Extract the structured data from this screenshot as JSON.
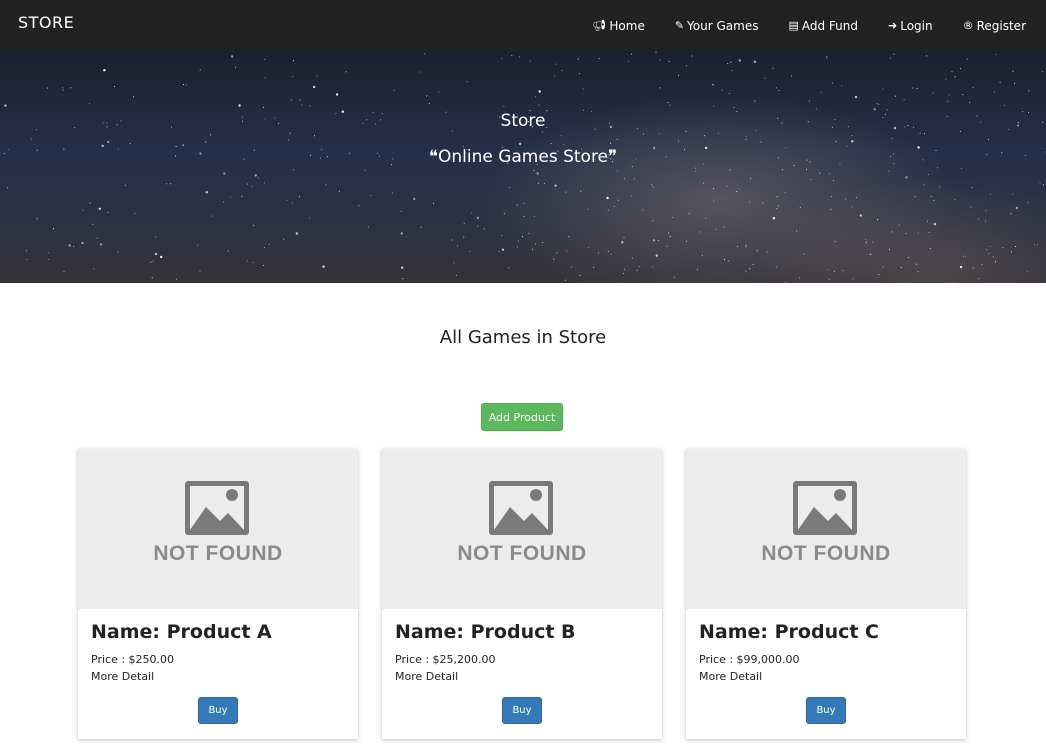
{
  "navbar": {
    "brand": "STORE",
    "links": [
      {
        "label": "Home",
        "icon": "bullhorn-icon"
      },
      {
        "label": "Your Games",
        "icon": "edit-icon"
      },
      {
        "label": "Add Fund",
        "icon": "book-icon"
      },
      {
        "label": "Login",
        "icon": "sign-in-icon"
      },
      {
        "label": "Register",
        "icon": "registered-icon"
      }
    ]
  },
  "hero": {
    "title": "Store",
    "subtitle": "❝Online Games Store❞"
  },
  "main": {
    "section_title": "All Games in Store",
    "add_button": "Add Product",
    "placeholder_text": "NOT FOUND",
    "products": [
      {
        "name": "Name: Product A",
        "price": "Price : $250.00",
        "detail": "More Detail",
        "buy": "Buy"
      },
      {
        "name": "Name: Product B",
        "price": "Price : $25,200.00",
        "detail": "More Detail",
        "buy": "Buy"
      },
      {
        "name": "Name: Product C",
        "price": "Price : $99,000.00",
        "detail": "More Detail",
        "buy": "Buy"
      }
    ]
  },
  "colors": {
    "navbar": "#222222",
    "add_button": "#5cb85c",
    "buy_button": "#337ab7",
    "placeholder_bg": "#ececec"
  }
}
